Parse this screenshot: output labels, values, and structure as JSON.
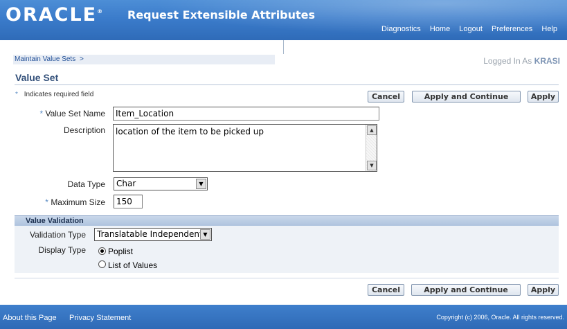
{
  "header": {
    "logo": "ORACLE",
    "app_title": "Request Extensible Attributes",
    "links": [
      "Diagnostics",
      "Home",
      "Logout",
      "Preferences",
      "Help"
    ]
  },
  "breadcrumb": {
    "item": "Maintain Value Sets",
    "separator": ">"
  },
  "session": {
    "logged_in_label": "Logged In As",
    "user": "KRASI"
  },
  "page": {
    "title": "Value Set",
    "required_note": "Indicates required field"
  },
  "buttons": {
    "cancel": "Cancel",
    "apply_continue": "Apply and Continue",
    "apply": "Apply"
  },
  "form": {
    "value_set_name": {
      "label": "Value Set Name",
      "value": "Item_Location"
    },
    "description": {
      "label": "Description",
      "value": "location of the item to be picked up"
    },
    "data_type": {
      "label": "Data Type",
      "value": "Char"
    },
    "maximum_size": {
      "label": "Maximum Size",
      "value": "150"
    }
  },
  "validation": {
    "section_title": "Value Validation",
    "validation_type": {
      "label": "Validation Type",
      "value": "Translatable Independent"
    },
    "display_type": {
      "label": "Display Type",
      "options": [
        "Poplist",
        "List of Values"
      ],
      "selected": "Poplist"
    }
  },
  "footer": {
    "links": [
      "About this Page",
      "Privacy Statement"
    ],
    "copyright": "Copyright (c) 2006, Oracle. All rights reserved."
  }
}
